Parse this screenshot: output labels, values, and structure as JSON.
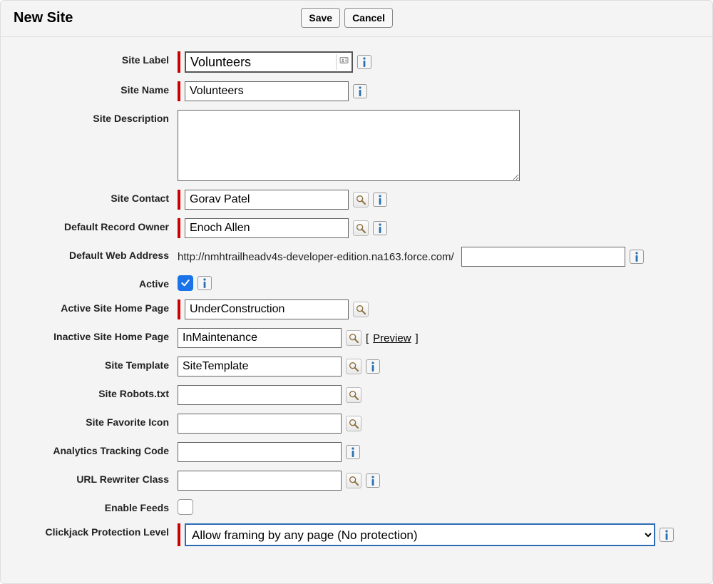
{
  "header": {
    "title": "New Site",
    "save_label": "Save",
    "cancel_label": "Cancel"
  },
  "labels": {
    "site_label": "Site Label",
    "site_name": "Site Name",
    "site_description": "Site Description",
    "site_contact": "Site Contact",
    "default_record_owner": "Default Record Owner",
    "default_web_address": "Default Web Address",
    "active": "Active",
    "active_home": "Active Site Home Page",
    "inactive_home": "Inactive Site Home Page",
    "site_template": "Site Template",
    "robots": "Site Robots.txt",
    "favicon": "Site Favorite Icon",
    "analytics": "Analytics Tracking Code",
    "url_rewriter": "URL Rewriter Class",
    "enable_feeds": "Enable Feeds",
    "clickjack": "Clickjack Protection Level"
  },
  "values": {
    "site_label": "Volunteers",
    "site_name": "Volunteers",
    "site_description": "",
    "site_contact": "Gorav Patel",
    "default_record_owner": "Enoch Allen",
    "web_address_prefix": "http://nmhtrailheadv4s-developer-edition.na163.force.com/",
    "web_address_suffix": "",
    "active_checked": true,
    "active_home": "UnderConstruction",
    "inactive_home": "InMaintenance",
    "site_template": "SiteTemplate",
    "robots": "",
    "favicon": "",
    "analytics": "",
    "url_rewriter": "",
    "enable_feeds_checked": false,
    "clickjack_selected": "Allow framing by any page (No protection)"
  },
  "links": {
    "preview": "Preview"
  }
}
